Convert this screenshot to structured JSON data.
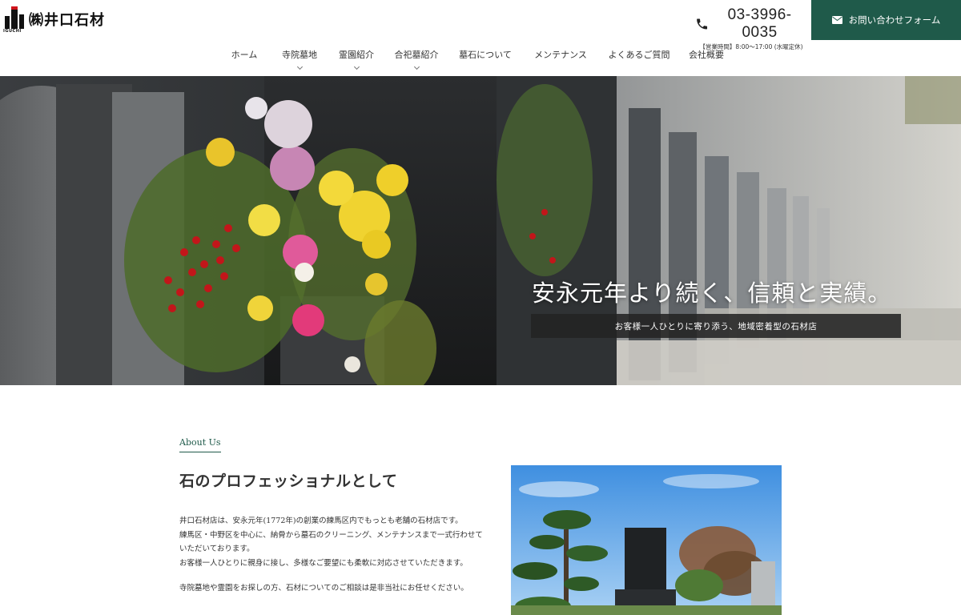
{
  "header": {
    "logo_text": "㈱井口石材",
    "logo_sub": "IGUCHI",
    "phone_number": "03-3996-0035",
    "phone_hours": "【営業時間】8:00～17:00 (水曜定休)",
    "contact_label": "お問い合わせフォーム",
    "accent_color": "#1f5a4a"
  },
  "nav": {
    "items": [
      {
        "label": "ホーム",
        "has_dropdown": false
      },
      {
        "label": "寺院墓地",
        "has_dropdown": true
      },
      {
        "label": "霊園紹介",
        "has_dropdown": true
      },
      {
        "label": "合祀墓紹介",
        "has_dropdown": true
      },
      {
        "label": "墓石について",
        "has_dropdown": false
      },
      {
        "label": "メンテナンス",
        "has_dropdown": false
      },
      {
        "label": "よくあるご質問",
        "has_dropdown": false
      },
      {
        "label": "会社概要",
        "has_dropdown": false
      }
    ]
  },
  "hero": {
    "headline": "安永元年より続く、信頼と実績。",
    "subline": "お客様一人ひとりに寄り添う、地域密着型の石材店"
  },
  "about": {
    "label": "About Us",
    "title": "石のプロフェッショナルとして",
    "lines": [
      "井口石材店は、安永元年(1772年)の創業の練馬区内でもっとも老舗の石材店です。",
      "練馬区・中野区を中心に、納骨から墓石のクリーニング、メンテナンスまで一式行わせて",
      "いただいております。",
      "お客様一人ひとりに親身に接し、多様なご要望にも柔軟に対応させていただきます。",
      "",
      "寺院墓地や霊園をお探しの方、石材についてのご相談は是非当社にお任せください。"
    ]
  }
}
